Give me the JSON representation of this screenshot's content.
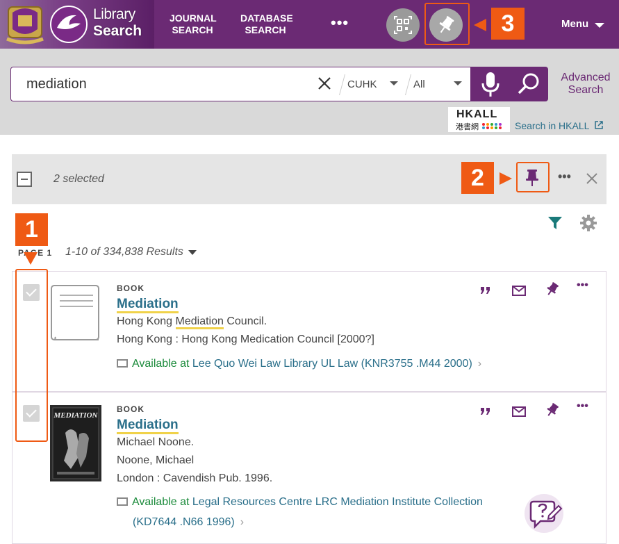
{
  "header": {
    "logo_line1": "Library",
    "logo_line2": "Search",
    "nav": [
      {
        "label": "JOURNAL\nSEARCH"
      },
      {
        "label": "DATABASE\nSEARCH"
      }
    ],
    "more": "•••",
    "menu": "Menu"
  },
  "search": {
    "value": "mediation",
    "scope1": "CUHK",
    "scope2": "All",
    "advanced": "Advanced Search",
    "hkall_logo_top": "HKALL",
    "hkall_logo_bottom": "港書網",
    "hkall_link": "Search in HKALL"
  },
  "selection": {
    "text": "2 selected",
    "more": "•••"
  },
  "results_header": {
    "page": "PAGE 1",
    "range": "1-10 of 334,838 Results"
  },
  "results": [
    {
      "type": "BOOK",
      "title": "Mediation",
      "line1_pre": "Hong Kong ",
      "line1_hl": "Mediation",
      "line1_post": " Council.",
      "line2": "Hong Kong : Hong Kong Medication Council [2000?]",
      "avail_prefix": "Available at",
      "avail_loc": "Lee Quo Wei Law Library  UL Law (KNR3755 .M44 2000)",
      "more": "•••"
    },
    {
      "type": "BOOK",
      "title": "Mediation",
      "line1": "Michael Noone.",
      "line2": "Noone, Michael",
      "line3": "London : Cavendish Pub. 1996.",
      "avail_prefix": "Available at",
      "avail_loc": "Legal Resources Centre  LRC Mediation Institute Collection",
      "avail_loc2": "(KD7644 .N66 1996)",
      "cover_text": "MEDIATION",
      "more": "•••"
    }
  ],
  "annotations": {
    "badge1": "1",
    "badge2": "2",
    "badge3": "3"
  },
  "colors": {
    "brand": "#6b2a74",
    "annotation": "#ef5a14",
    "link": "#2a6f8a",
    "available": "#1a8a3a",
    "highlight": "#f0d24a"
  }
}
